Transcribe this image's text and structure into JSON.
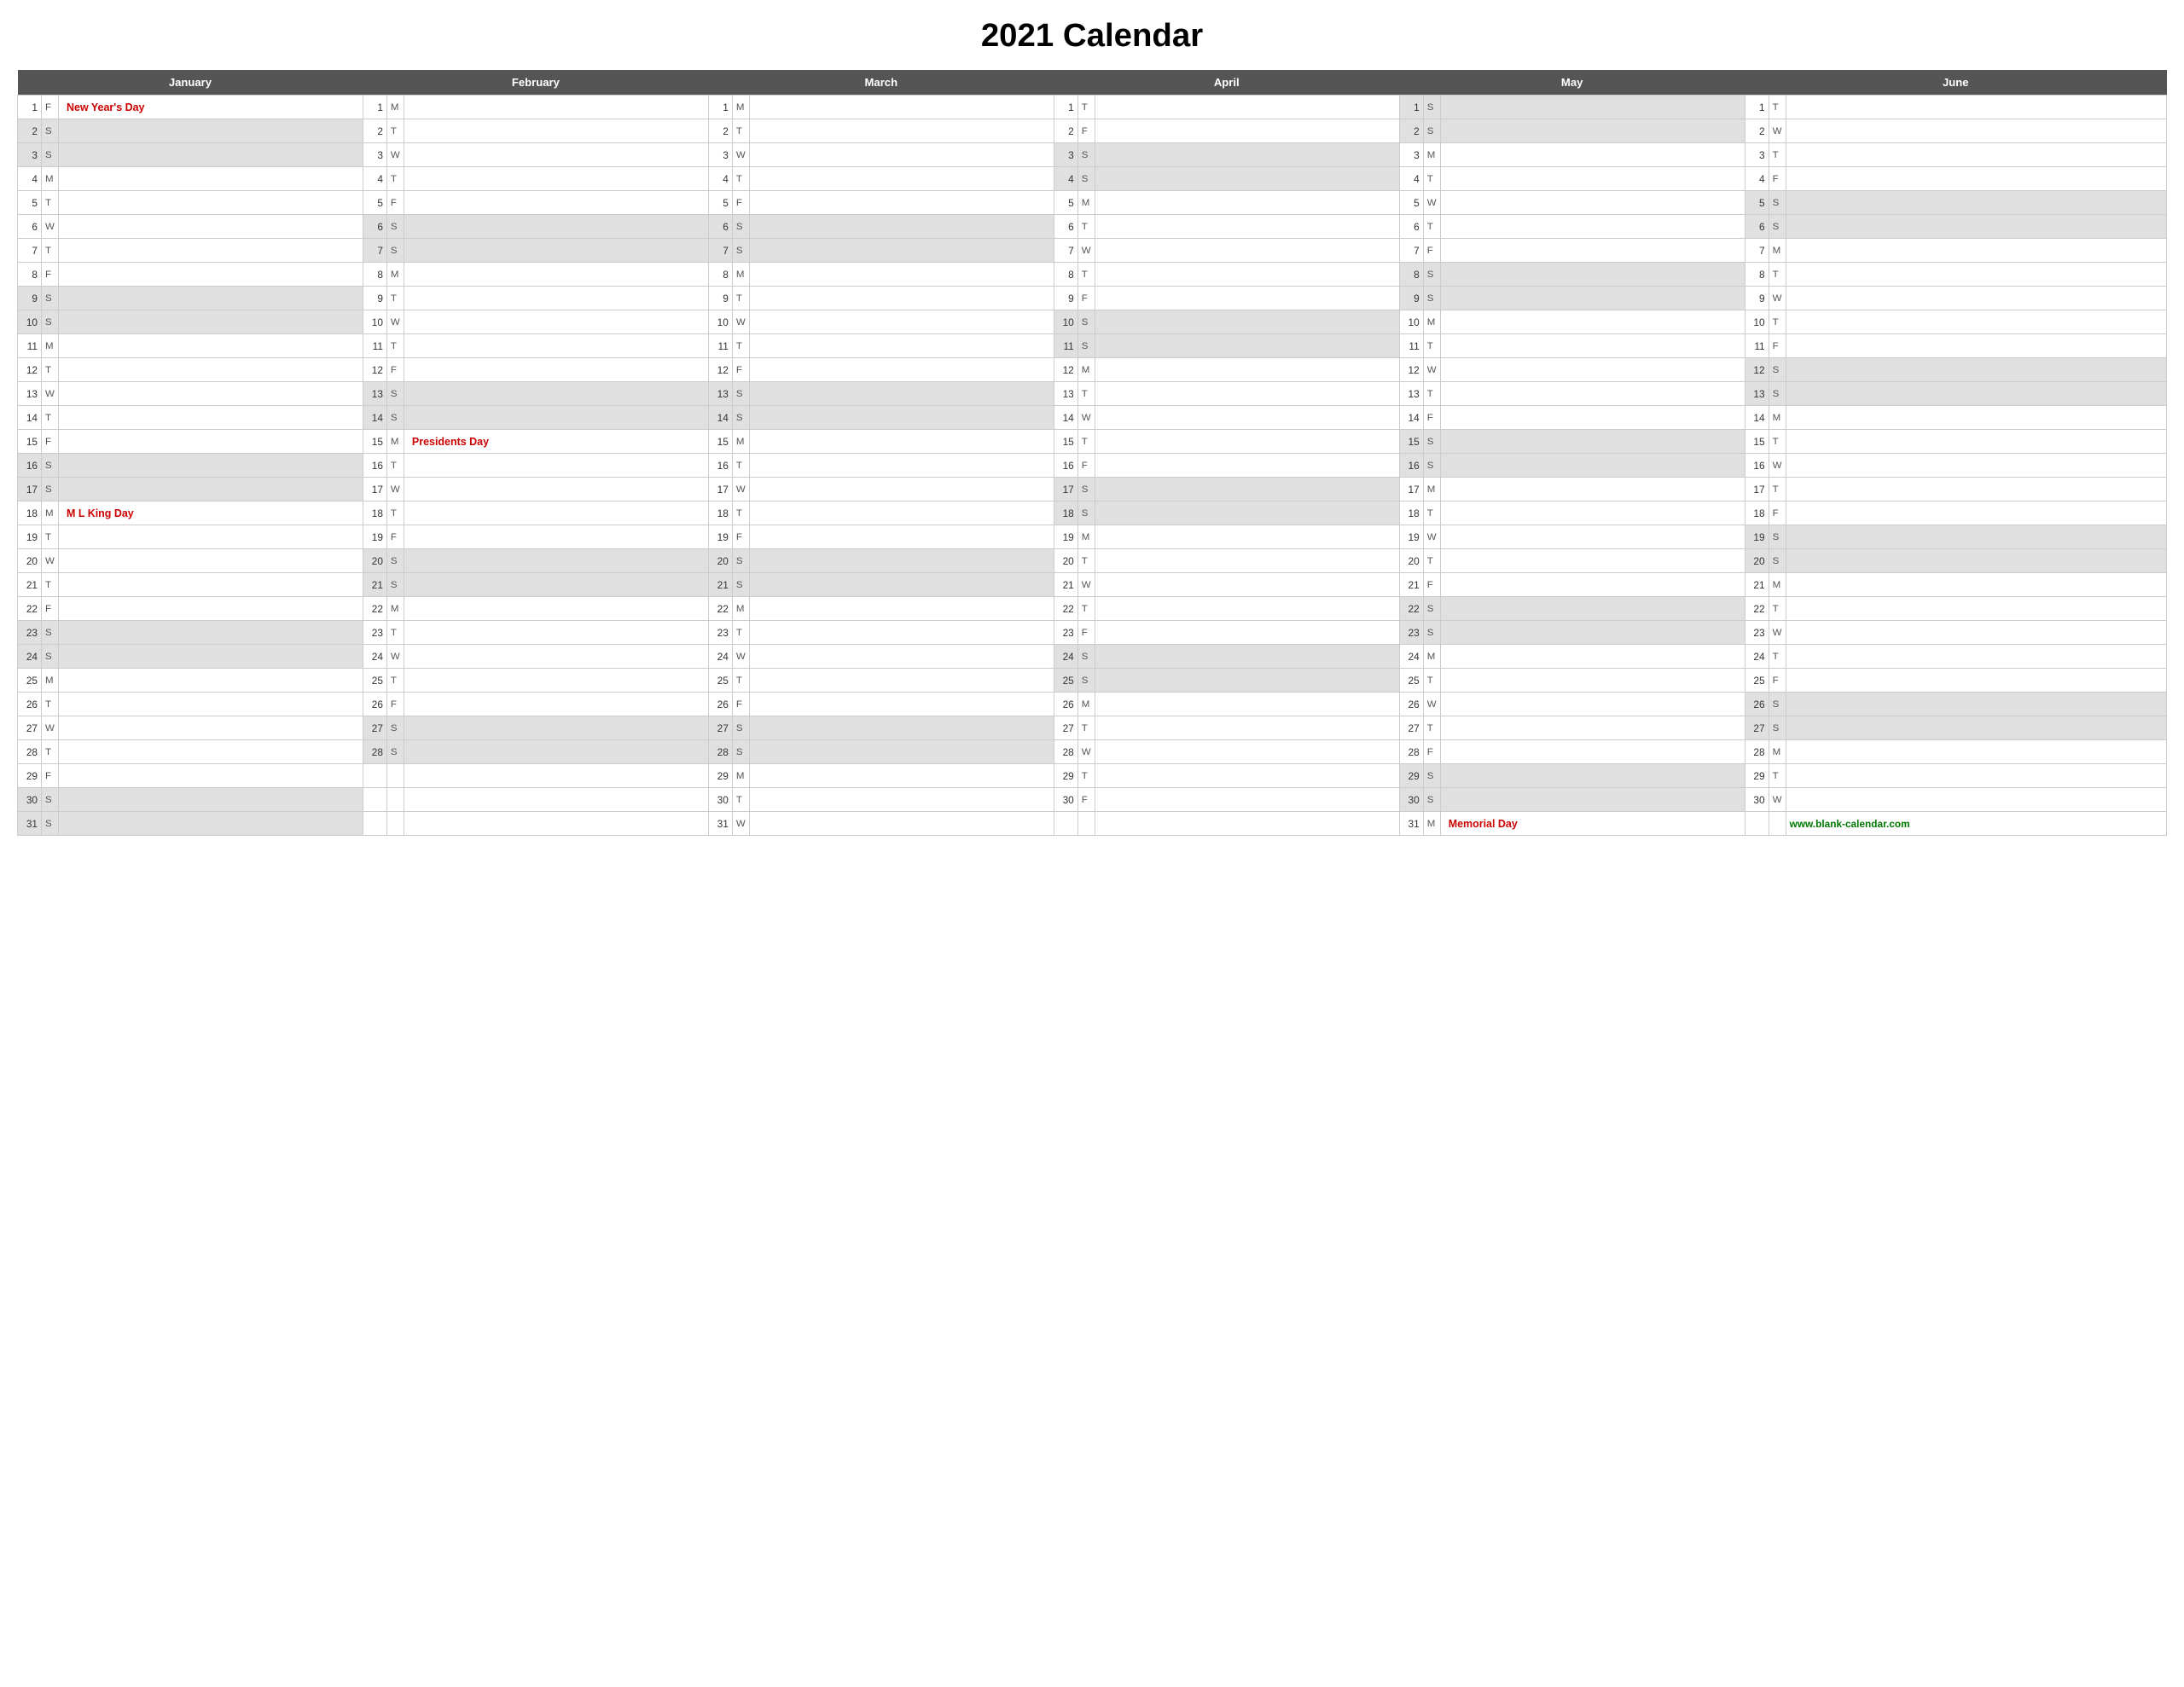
{
  "title": "2021 Calendar",
  "website": "www.blank-calendar.com",
  "months": [
    {
      "name": "January",
      "col_span": 3
    },
    {
      "name": "February",
      "col_span": 3
    },
    {
      "name": "March",
      "col_span": 3
    },
    {
      "name": "April",
      "col_span": 3
    },
    {
      "name": "May",
      "col_span": 3
    },
    {
      "name": "June",
      "col_span": 3
    }
  ],
  "days": {
    "jan": [
      {
        "d": 1,
        "l": "F",
        "h": "New Year's Day",
        "shaded": false
      },
      {
        "d": 2,
        "l": "S",
        "h": "",
        "shaded": true
      },
      {
        "d": 3,
        "l": "S",
        "h": "",
        "shaded": true
      },
      {
        "d": 4,
        "l": "M",
        "h": "",
        "shaded": false
      },
      {
        "d": 5,
        "l": "T",
        "h": "",
        "shaded": false
      },
      {
        "d": 6,
        "l": "W",
        "h": "",
        "shaded": false
      },
      {
        "d": 7,
        "l": "T",
        "h": "",
        "shaded": false
      },
      {
        "d": 8,
        "l": "F",
        "h": "",
        "shaded": false
      },
      {
        "d": 9,
        "l": "S",
        "h": "",
        "shaded": true
      },
      {
        "d": 10,
        "l": "S",
        "h": "",
        "shaded": true
      },
      {
        "d": 11,
        "l": "M",
        "h": "",
        "shaded": false
      },
      {
        "d": 12,
        "l": "T",
        "h": "",
        "shaded": false
      },
      {
        "d": 13,
        "l": "W",
        "h": "",
        "shaded": false
      },
      {
        "d": 14,
        "l": "T",
        "h": "",
        "shaded": false
      },
      {
        "d": 15,
        "l": "F",
        "h": "",
        "shaded": false
      },
      {
        "d": 16,
        "l": "S",
        "h": "",
        "shaded": true
      },
      {
        "d": 17,
        "l": "S",
        "h": "",
        "shaded": true
      },
      {
        "d": 18,
        "l": "M",
        "h": "M L King Day",
        "shaded": false
      },
      {
        "d": 19,
        "l": "T",
        "h": "",
        "shaded": false
      },
      {
        "d": 20,
        "l": "W",
        "h": "",
        "shaded": false
      },
      {
        "d": 21,
        "l": "T",
        "h": "",
        "shaded": false
      },
      {
        "d": 22,
        "l": "F",
        "h": "",
        "shaded": false
      },
      {
        "d": 23,
        "l": "S",
        "h": "",
        "shaded": true
      },
      {
        "d": 24,
        "l": "S",
        "h": "",
        "shaded": true
      },
      {
        "d": 25,
        "l": "M",
        "h": "",
        "shaded": false
      },
      {
        "d": 26,
        "l": "T",
        "h": "",
        "shaded": false
      },
      {
        "d": 27,
        "l": "W",
        "h": "",
        "shaded": false
      },
      {
        "d": 28,
        "l": "T",
        "h": "",
        "shaded": false
      },
      {
        "d": 29,
        "l": "F",
        "h": "",
        "shaded": false
      },
      {
        "d": 30,
        "l": "S",
        "h": "",
        "shaded": true
      },
      {
        "d": 31,
        "l": "S",
        "h": "",
        "shaded": true
      }
    ],
    "feb": [
      {
        "d": 1,
        "l": "M",
        "h": "",
        "shaded": false
      },
      {
        "d": 2,
        "l": "T",
        "h": "",
        "shaded": false
      },
      {
        "d": 3,
        "l": "W",
        "h": "",
        "shaded": false
      },
      {
        "d": 4,
        "l": "T",
        "h": "",
        "shaded": false
      },
      {
        "d": 5,
        "l": "F",
        "h": "",
        "shaded": false
      },
      {
        "d": 6,
        "l": "S",
        "h": "",
        "shaded": true
      },
      {
        "d": 7,
        "l": "S",
        "h": "",
        "shaded": true
      },
      {
        "d": 8,
        "l": "M",
        "h": "",
        "shaded": false
      },
      {
        "d": 9,
        "l": "T",
        "h": "",
        "shaded": false
      },
      {
        "d": 10,
        "l": "W",
        "h": "",
        "shaded": false
      },
      {
        "d": 11,
        "l": "T",
        "h": "",
        "shaded": false
      },
      {
        "d": 12,
        "l": "F",
        "h": "",
        "shaded": false
      },
      {
        "d": 13,
        "l": "S",
        "h": "",
        "shaded": true
      },
      {
        "d": 14,
        "l": "S",
        "h": "",
        "shaded": true
      },
      {
        "d": 15,
        "l": "M",
        "h": "Presidents Day",
        "shaded": false
      },
      {
        "d": 16,
        "l": "T",
        "h": "",
        "shaded": false
      },
      {
        "d": 17,
        "l": "W",
        "h": "",
        "shaded": false
      },
      {
        "d": 18,
        "l": "T",
        "h": "",
        "shaded": false
      },
      {
        "d": 19,
        "l": "F",
        "h": "",
        "shaded": false
      },
      {
        "d": 20,
        "l": "S",
        "h": "",
        "shaded": true
      },
      {
        "d": 21,
        "l": "S",
        "h": "",
        "shaded": true
      },
      {
        "d": 22,
        "l": "M",
        "h": "",
        "shaded": false
      },
      {
        "d": 23,
        "l": "T",
        "h": "",
        "shaded": false
      },
      {
        "d": 24,
        "l": "W",
        "h": "",
        "shaded": false
      },
      {
        "d": 25,
        "l": "T",
        "h": "",
        "shaded": false
      },
      {
        "d": 26,
        "l": "F",
        "h": "",
        "shaded": false
      },
      {
        "d": 27,
        "l": "S",
        "h": "",
        "shaded": true
      },
      {
        "d": 28,
        "l": "S",
        "h": "",
        "shaded": true
      }
    ],
    "mar": [
      {
        "d": 1,
        "l": "M",
        "h": "",
        "shaded": false
      },
      {
        "d": 2,
        "l": "T",
        "h": "",
        "shaded": false
      },
      {
        "d": 3,
        "l": "W",
        "h": "",
        "shaded": false
      },
      {
        "d": 4,
        "l": "T",
        "h": "",
        "shaded": false
      },
      {
        "d": 5,
        "l": "F",
        "h": "",
        "shaded": false
      },
      {
        "d": 6,
        "l": "S",
        "h": "",
        "shaded": true
      },
      {
        "d": 7,
        "l": "S",
        "h": "",
        "shaded": true
      },
      {
        "d": 8,
        "l": "M",
        "h": "",
        "shaded": false
      },
      {
        "d": 9,
        "l": "T",
        "h": "",
        "shaded": false
      },
      {
        "d": 10,
        "l": "W",
        "h": "",
        "shaded": false
      },
      {
        "d": 11,
        "l": "T",
        "h": "",
        "shaded": false
      },
      {
        "d": 12,
        "l": "F",
        "h": "",
        "shaded": false
      },
      {
        "d": 13,
        "l": "S",
        "h": "",
        "shaded": true
      },
      {
        "d": 14,
        "l": "S",
        "h": "",
        "shaded": true
      },
      {
        "d": 15,
        "l": "M",
        "h": "",
        "shaded": false
      },
      {
        "d": 16,
        "l": "T",
        "h": "",
        "shaded": false
      },
      {
        "d": 17,
        "l": "W",
        "h": "",
        "shaded": false
      },
      {
        "d": 18,
        "l": "T",
        "h": "",
        "shaded": false
      },
      {
        "d": 19,
        "l": "F",
        "h": "",
        "shaded": false
      },
      {
        "d": 20,
        "l": "S",
        "h": "",
        "shaded": true
      },
      {
        "d": 21,
        "l": "S",
        "h": "",
        "shaded": true
      },
      {
        "d": 22,
        "l": "M",
        "h": "",
        "shaded": false
      },
      {
        "d": 23,
        "l": "T",
        "h": "",
        "shaded": false
      },
      {
        "d": 24,
        "l": "W",
        "h": "",
        "shaded": false
      },
      {
        "d": 25,
        "l": "T",
        "h": "",
        "shaded": false
      },
      {
        "d": 26,
        "l": "F",
        "h": "",
        "shaded": false
      },
      {
        "d": 27,
        "l": "S",
        "h": "",
        "shaded": true
      },
      {
        "d": 28,
        "l": "S",
        "h": "",
        "shaded": true
      },
      {
        "d": 29,
        "l": "M",
        "h": "",
        "shaded": false
      },
      {
        "d": 30,
        "l": "T",
        "h": "",
        "shaded": false
      },
      {
        "d": 31,
        "l": "W",
        "h": "",
        "shaded": false
      }
    ],
    "apr": [
      {
        "d": 1,
        "l": "T",
        "h": "",
        "shaded": false
      },
      {
        "d": 2,
        "l": "F",
        "h": "",
        "shaded": false
      },
      {
        "d": 3,
        "l": "S",
        "h": "",
        "shaded": true
      },
      {
        "d": 4,
        "l": "S",
        "h": "",
        "shaded": true
      },
      {
        "d": 5,
        "l": "M",
        "h": "",
        "shaded": false
      },
      {
        "d": 6,
        "l": "T",
        "h": "",
        "shaded": false
      },
      {
        "d": 7,
        "l": "W",
        "h": "",
        "shaded": false
      },
      {
        "d": 8,
        "l": "T",
        "h": "",
        "shaded": false
      },
      {
        "d": 9,
        "l": "F",
        "h": "",
        "shaded": false
      },
      {
        "d": 10,
        "l": "S",
        "h": "",
        "shaded": true
      },
      {
        "d": 11,
        "l": "S",
        "h": "",
        "shaded": true
      },
      {
        "d": 12,
        "l": "M",
        "h": "",
        "shaded": false
      },
      {
        "d": 13,
        "l": "T",
        "h": "",
        "shaded": false
      },
      {
        "d": 14,
        "l": "W",
        "h": "",
        "shaded": false
      },
      {
        "d": 15,
        "l": "T",
        "h": "",
        "shaded": false
      },
      {
        "d": 16,
        "l": "F",
        "h": "",
        "shaded": false
      },
      {
        "d": 17,
        "l": "S",
        "h": "",
        "shaded": true
      },
      {
        "d": 18,
        "l": "S",
        "h": "",
        "shaded": true
      },
      {
        "d": 19,
        "l": "M",
        "h": "",
        "shaded": false
      },
      {
        "d": 20,
        "l": "T",
        "h": "",
        "shaded": false
      },
      {
        "d": 21,
        "l": "W",
        "h": "",
        "shaded": false
      },
      {
        "d": 22,
        "l": "T",
        "h": "",
        "shaded": false
      },
      {
        "d": 23,
        "l": "F",
        "h": "",
        "shaded": false
      },
      {
        "d": 24,
        "l": "S",
        "h": "",
        "shaded": true
      },
      {
        "d": 25,
        "l": "S",
        "h": "",
        "shaded": true
      },
      {
        "d": 26,
        "l": "M",
        "h": "",
        "shaded": false
      },
      {
        "d": 27,
        "l": "T",
        "h": "",
        "shaded": false
      },
      {
        "d": 28,
        "l": "W",
        "h": "",
        "shaded": false
      },
      {
        "d": 29,
        "l": "T",
        "h": "",
        "shaded": false
      },
      {
        "d": 30,
        "l": "F",
        "h": "",
        "shaded": false
      }
    ],
    "may": [
      {
        "d": 1,
        "l": "S",
        "h": "",
        "shaded": true
      },
      {
        "d": 2,
        "l": "S",
        "h": "",
        "shaded": true
      },
      {
        "d": 3,
        "l": "M",
        "h": "",
        "shaded": false
      },
      {
        "d": 4,
        "l": "T",
        "h": "",
        "shaded": false
      },
      {
        "d": 5,
        "l": "W",
        "h": "",
        "shaded": false
      },
      {
        "d": 6,
        "l": "T",
        "h": "",
        "shaded": false
      },
      {
        "d": 7,
        "l": "F",
        "h": "",
        "shaded": false
      },
      {
        "d": 8,
        "l": "S",
        "h": "",
        "shaded": true
      },
      {
        "d": 9,
        "l": "S",
        "h": "",
        "shaded": true
      },
      {
        "d": 10,
        "l": "M",
        "h": "",
        "shaded": false
      },
      {
        "d": 11,
        "l": "T",
        "h": "",
        "shaded": false
      },
      {
        "d": 12,
        "l": "W",
        "h": "",
        "shaded": false
      },
      {
        "d": 13,
        "l": "T",
        "h": "",
        "shaded": false
      },
      {
        "d": 14,
        "l": "F",
        "h": "",
        "shaded": false
      },
      {
        "d": 15,
        "l": "S",
        "h": "",
        "shaded": true
      },
      {
        "d": 16,
        "l": "S",
        "h": "",
        "shaded": true
      },
      {
        "d": 17,
        "l": "M",
        "h": "",
        "shaded": false
      },
      {
        "d": 18,
        "l": "T",
        "h": "",
        "shaded": false
      },
      {
        "d": 19,
        "l": "W",
        "h": "",
        "shaded": false
      },
      {
        "d": 20,
        "l": "T",
        "h": "",
        "shaded": false
      },
      {
        "d": 21,
        "l": "F",
        "h": "",
        "shaded": false
      },
      {
        "d": 22,
        "l": "S",
        "h": "",
        "shaded": true
      },
      {
        "d": 23,
        "l": "S",
        "h": "",
        "shaded": true
      },
      {
        "d": 24,
        "l": "M",
        "h": "",
        "shaded": false
      },
      {
        "d": 25,
        "l": "T",
        "h": "",
        "shaded": false
      },
      {
        "d": 26,
        "l": "W",
        "h": "",
        "shaded": false
      },
      {
        "d": 27,
        "l": "T",
        "h": "",
        "shaded": false
      },
      {
        "d": 28,
        "l": "F",
        "h": "",
        "shaded": false
      },
      {
        "d": 29,
        "l": "S",
        "h": "",
        "shaded": true
      },
      {
        "d": 30,
        "l": "S",
        "h": "",
        "shaded": true
      },
      {
        "d": 31,
        "l": "M",
        "h": "Memorial Day",
        "shaded": false
      }
    ],
    "jun": [
      {
        "d": 1,
        "l": "T",
        "h": "",
        "shaded": false
      },
      {
        "d": 2,
        "l": "W",
        "h": "",
        "shaded": false
      },
      {
        "d": 3,
        "l": "T",
        "h": "",
        "shaded": false
      },
      {
        "d": 4,
        "l": "F",
        "h": "",
        "shaded": false
      },
      {
        "d": 5,
        "l": "S",
        "h": "",
        "shaded": true
      },
      {
        "d": 6,
        "l": "S",
        "h": "",
        "shaded": true
      },
      {
        "d": 7,
        "l": "M",
        "h": "",
        "shaded": false
      },
      {
        "d": 8,
        "l": "T",
        "h": "",
        "shaded": false
      },
      {
        "d": 9,
        "l": "W",
        "h": "",
        "shaded": false
      },
      {
        "d": 10,
        "l": "T",
        "h": "",
        "shaded": false
      },
      {
        "d": 11,
        "l": "F",
        "h": "",
        "shaded": false
      },
      {
        "d": 12,
        "l": "S",
        "h": "",
        "shaded": true
      },
      {
        "d": 13,
        "l": "S",
        "h": "",
        "shaded": true
      },
      {
        "d": 14,
        "l": "M",
        "h": "",
        "shaded": false
      },
      {
        "d": 15,
        "l": "T",
        "h": "",
        "shaded": false
      },
      {
        "d": 16,
        "l": "W",
        "h": "",
        "shaded": false
      },
      {
        "d": 17,
        "l": "T",
        "h": "",
        "shaded": false
      },
      {
        "d": 18,
        "l": "F",
        "h": "",
        "shaded": false
      },
      {
        "d": 19,
        "l": "S",
        "h": "",
        "shaded": true
      },
      {
        "d": 20,
        "l": "S",
        "h": "",
        "shaded": true
      },
      {
        "d": 21,
        "l": "M",
        "h": "",
        "shaded": false
      },
      {
        "d": 22,
        "l": "T",
        "h": "",
        "shaded": false
      },
      {
        "d": 23,
        "l": "W",
        "h": "",
        "shaded": false
      },
      {
        "d": 24,
        "l": "T",
        "h": "",
        "shaded": false
      },
      {
        "d": 25,
        "l": "F",
        "h": "",
        "shaded": false
      },
      {
        "d": 26,
        "l": "S",
        "h": "",
        "shaded": true
      },
      {
        "d": 27,
        "l": "S",
        "h": "",
        "shaded": true
      },
      {
        "d": 28,
        "l": "M",
        "h": "",
        "shaded": false
      },
      {
        "d": 29,
        "l": "T",
        "h": "",
        "shaded": false
      },
      {
        "d": 30,
        "l": "W",
        "h": "",
        "shaded": false
      }
    ]
  }
}
